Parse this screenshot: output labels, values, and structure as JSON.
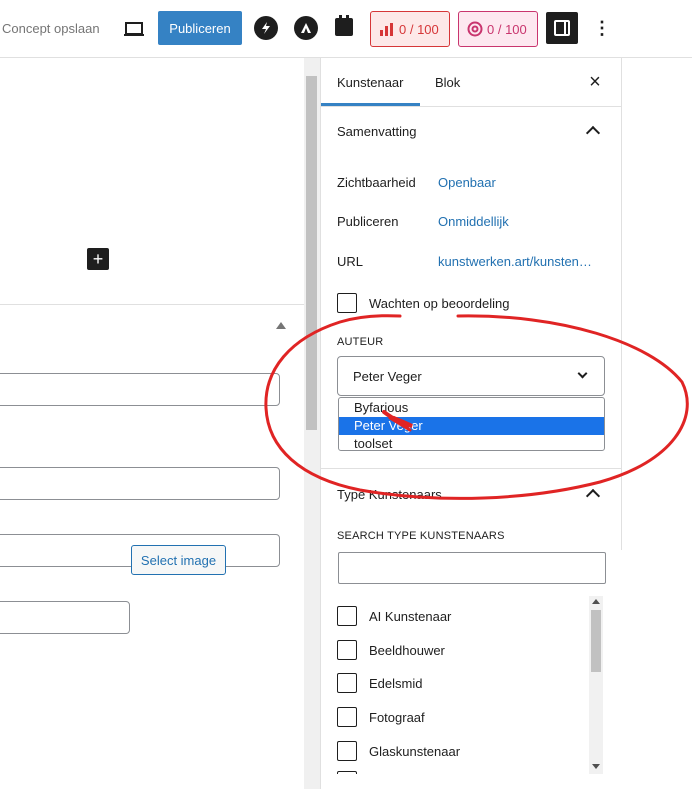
{
  "topbar": {
    "draft_label": "Concept opslaan",
    "preview_icon": "laptop-icon",
    "publish_label": "Publiceren",
    "plugin_icons": [
      "bolt-icon",
      "arrow-logo-icon",
      "clipboard-icon"
    ],
    "seo_score": "0 / 100",
    "readability_score": "0 / 100",
    "sidebar_toggle_icon": "sidebar-toggle-icon",
    "more_icon": "more-vertical-icon"
  },
  "editor": {
    "add_block_icon": "plus-icon",
    "select_image_label": "Select image"
  },
  "sidebar": {
    "tabs": [
      {
        "label": "Kunstenaar",
        "active": true
      },
      {
        "label": "Blok",
        "active": false
      }
    ],
    "close_icon": "close-icon",
    "summary": {
      "title": "Samenvatting",
      "rows": [
        {
          "label": "Zichtbaarheid",
          "value": "Openbaar"
        },
        {
          "label": "Publiceren",
          "value": "Onmiddellijk"
        },
        {
          "label": "URL",
          "value": "kunstwerken.art/kunsten…"
        }
      ],
      "pending_review_label": "Wachten op beoordeling",
      "author_label": "AUTEUR",
      "author_selected": "Peter Veger",
      "author_options": [
        {
          "label": "Byfarious",
          "selected": false
        },
        {
          "label": "Peter Veger",
          "selected": true
        },
        {
          "label": "toolset",
          "selected": false
        }
      ]
    },
    "taxonomy": {
      "title": "Type Kunstenaars",
      "search_label": "SEARCH TYPE KUNSTENAARS",
      "terms": [
        "AI Kunstenaar",
        "Beeldhouwer",
        "Edelsmid",
        "Fotograaf",
        "Glaskunstenaar"
      ]
    }
  },
  "colors": {
    "accent": "#3582c4",
    "link": "#2271b1",
    "annotation": "#e02424",
    "option_highlight": "#1a73e8"
  }
}
